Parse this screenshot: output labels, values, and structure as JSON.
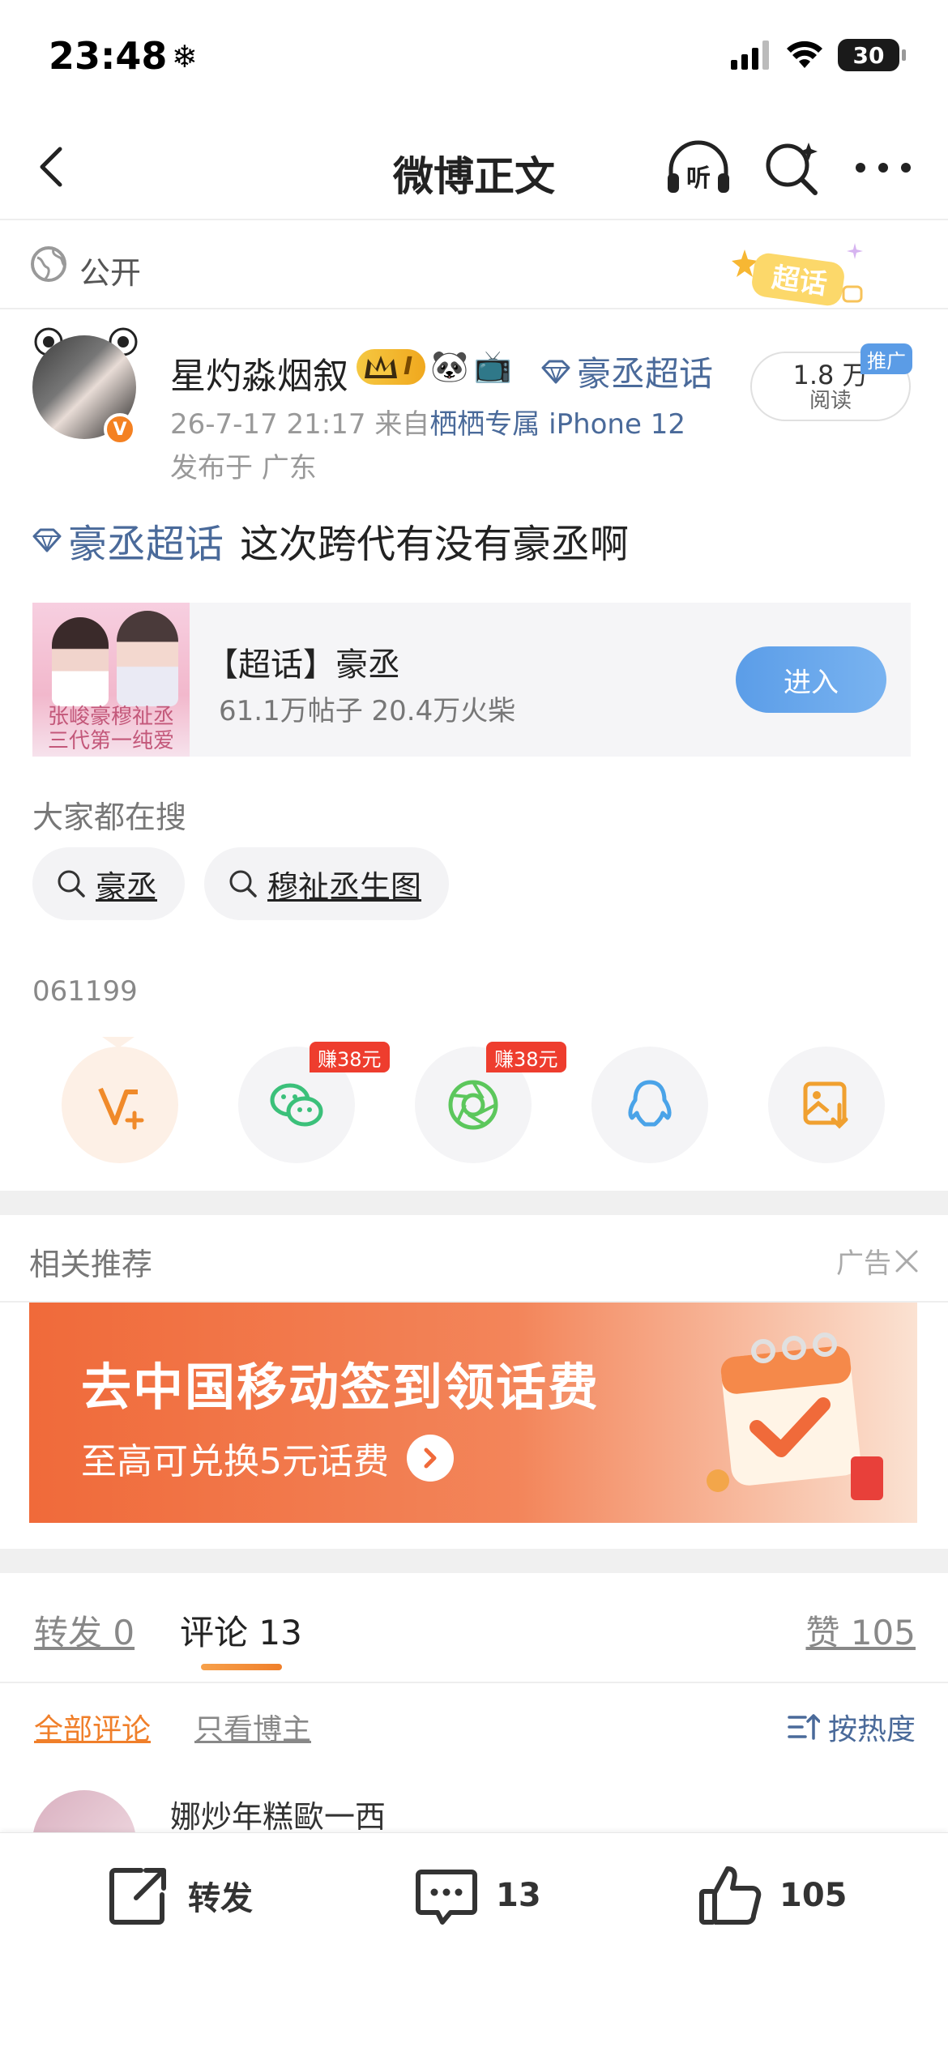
{
  "status": {
    "time": "23:48",
    "snow": "❄",
    "battery": "30"
  },
  "nav": {
    "title": "微博正文",
    "listen_icon": "headphones-listen-icon"
  },
  "visibility": {
    "label": "公开",
    "badge": "超话"
  },
  "author": {
    "name": "星灼淼烟叙",
    "level_badge": "I",
    "emoji_badges": [
      "🐼",
      "📺"
    ],
    "supertopic": "豪丞超话",
    "time": "26-7-17 21:17",
    "source_prefix": "来自",
    "source": "栖栖专属 iPhone 12",
    "location": "发布于 广东",
    "reads_value": "1.8 万",
    "reads_label": "阅读",
    "promo_tag": "推广",
    "verified": "V"
  },
  "post": {
    "topic": "豪丞超话",
    "text": "这次跨代有没有豪丞啊"
  },
  "topic_card": {
    "thumb_caption_line1": "张峻豪穆祉丞",
    "thumb_caption_line2": "三代第一纯爱",
    "title": "【超话】豪丞",
    "stats": "61.1万帖子 20.4万火柴",
    "enter": "进入"
  },
  "search": {
    "heading": "大家都在搜",
    "chips": [
      {
        "label": "豪丞"
      },
      {
        "label": "穆祉丞生图"
      }
    ]
  },
  "ref_number": "061199",
  "share": {
    "items": [
      {
        "icon": "vplus-icon",
        "color": "#f08a2a"
      },
      {
        "icon": "wechat-icon",
        "color": "#3bc07a",
        "earn": "赚38元"
      },
      {
        "icon": "moments-icon",
        "color": "#5cc75c",
        "earn": "赚38元"
      },
      {
        "icon": "qq-icon",
        "color": "#4aa3e8"
      },
      {
        "icon": "save-image-icon",
        "color": "#f0a030"
      }
    ]
  },
  "recommend": {
    "title": "相关推荐",
    "ad_label": "广告"
  },
  "ad": {
    "line1": "去中国移动签到领话费",
    "line2": "至高可兑换5元话费"
  },
  "tabs": {
    "repost": "转发 0",
    "comment": "评论 13",
    "like": "赞 105"
  },
  "filters": {
    "all": "全部评论",
    "author_only": "只看博主",
    "sort": "按热度"
  },
  "comment": {
    "name": "娜炒年糕歐一西"
  },
  "bottom": {
    "repost": "转发",
    "comment_count": "13",
    "like_count": "105"
  },
  "colors": {
    "accent_orange": "#f07f2a",
    "link_blue": "#4a6a9a",
    "enter_blue": "#5b9de8"
  }
}
